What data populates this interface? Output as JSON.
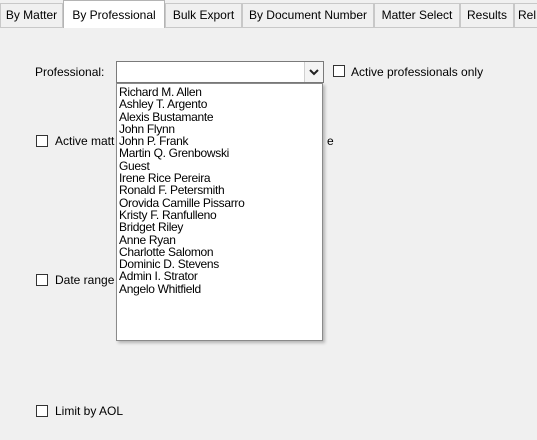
{
  "tabs": [
    {
      "label": "By Matter"
    },
    {
      "label": "By Professional"
    },
    {
      "label": "Bulk Export"
    },
    {
      "label": "By Document Number"
    },
    {
      "label": "Matter Select"
    },
    {
      "label": "Results"
    },
    {
      "label": "Rel"
    }
  ],
  "form": {
    "professional_label": "Professional:",
    "professional_value": "",
    "active_professionals_label": "Active professionals only",
    "active_matters_label": "Active matt",
    "partial_text": "e",
    "date_range_label": "Date range",
    "limit_aol_label": "Limit by AOL"
  },
  "dropdown": {
    "items": [
      "Richard M. Allen",
      "Ashley T. Argento",
      "Alexis Bustamante",
      "John Flynn",
      "John P. Frank",
      "Martin Q. Grenbowski",
      "Guest",
      "Irene Rice Pereira",
      "Ronald F. Petersmith",
      "Orovida Camille Pissarro",
      "Kristy F. Ranfulleno",
      "Bridget Riley",
      "Anne Ryan",
      "Charlotte Salomon",
      "Dominic D. Stevens",
      "Admin I. Strator",
      "Angelo Whitfield"
    ]
  },
  "icons": {
    "combo_arrow": "chevron-down-icon"
  }
}
